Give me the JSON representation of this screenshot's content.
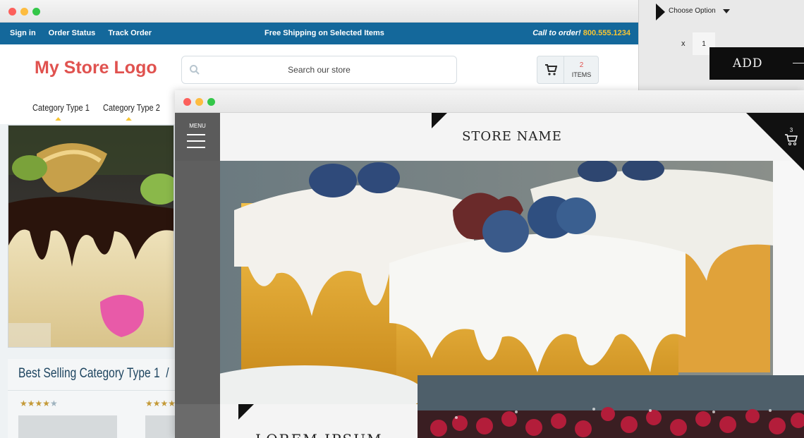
{
  "product_panel": {
    "option_label": "Choose Option",
    "qty_x": "x",
    "qty_value": "1",
    "add_label": "ADD"
  },
  "store_window": {
    "topbar": {
      "links": [
        "Sign in",
        "Order Status",
        "Track Order"
      ],
      "shipping": "Free Shipping on Selected Items",
      "call_text": "Call to order! ",
      "phone": "800.555.1234"
    },
    "logo": "My Store Logo",
    "search": {
      "placeholder": "Search our store"
    },
    "cart": {
      "count": "2",
      "items_label": "ITEMS"
    },
    "categories": [
      "Category Type 1",
      "Category Type 2"
    ],
    "best_selling": {
      "title": "Best Selling Category Type 1",
      "separator": "/",
      "ratings": [
        4,
        4
      ]
    }
  },
  "theme_window": {
    "menu_label": "MENU",
    "store_name": "STORE NAME",
    "cart_count": "3",
    "card_heading": "LOREM IPSUM"
  },
  "colors": {
    "topbar": "#14689b",
    "phone": "#f7c533",
    "logo": "#e0524f",
    "heading": "#1e4560",
    "star": "#c49a38"
  },
  "icons": [
    "search-icon",
    "cart-icon",
    "hamburger-icon",
    "caret-down-icon"
  ]
}
